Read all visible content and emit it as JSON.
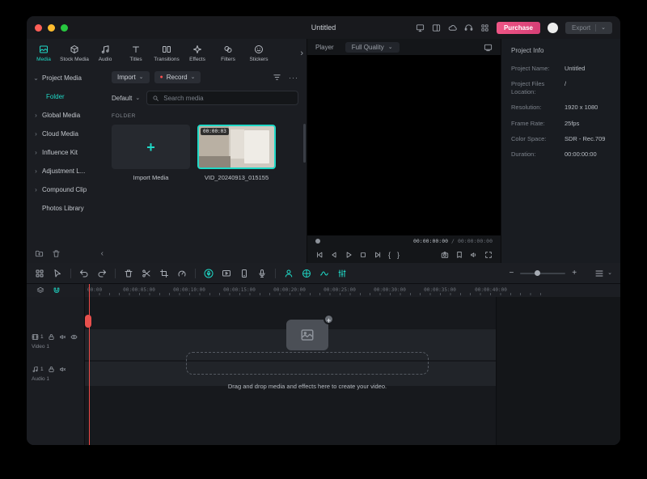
{
  "glyphs": {
    "caret_down": "⌄",
    "chevron_right": "›",
    "chevron_left": "‹",
    "plus": "+",
    "minus": "−",
    "more": "···",
    "record_dot": "●",
    "slash": "/",
    "mark_in": "{",
    "mark_out": "}"
  },
  "titlebar": {
    "title": "Untitled",
    "purchase_label": "Purchase",
    "export_label": "Export"
  },
  "media_panel": {
    "tabs": [
      {
        "label": "Media"
      },
      {
        "label": "Stock Media"
      },
      {
        "label": "Audio"
      },
      {
        "label": "Titles"
      },
      {
        "label": "Transitions"
      },
      {
        "label": "Effects"
      },
      {
        "label": "Filters"
      },
      {
        "label": "Stickers"
      }
    ],
    "sidebar": [
      {
        "label": "Project Media",
        "chevron": "⌄"
      },
      {
        "label": "Folder",
        "chevron": ""
      },
      {
        "label": "Global Media",
        "chevron": "›"
      },
      {
        "label": "Cloud Media",
        "chevron": "›"
      },
      {
        "label": "Influence Kit",
        "chevron": "›"
      },
      {
        "label": "Adjustment L...",
        "chevron": "›"
      },
      {
        "label": "Compound Clip",
        "chevron": "›"
      },
      {
        "label": "Photos Library",
        "chevron": ""
      }
    ],
    "import_label": "Import",
    "record_label": "Record",
    "sort_label": "Default",
    "search_placeholder": "Search media",
    "section_label": "FOLDER",
    "import_tile_label": "Import Media",
    "video_item": {
      "name": "VID_20240913_015155",
      "duration": "00:00:03"
    }
  },
  "preview": {
    "player_label": "Player",
    "quality_label": "Full Quality",
    "current_time": "00:00:00:00",
    "total_time": "00:00:00:00"
  },
  "project_info": {
    "title": "Project Info",
    "fields": [
      {
        "label": "Project Name:",
        "value": "Untitled"
      },
      {
        "label": "Project Files Location:",
        "value": "/"
      },
      {
        "label": "Resolution:",
        "value": "1920 x 1080"
      },
      {
        "label": "Frame Rate:",
        "value": "25fps"
      },
      {
        "label": "Color Space:",
        "value": "SDR - Rec.709"
      },
      {
        "label": "Duration:",
        "value": "00:00:00:00"
      }
    ]
  },
  "timeline": {
    "ruler_labels": [
      "00:00",
      "00:00:05:00",
      "00:00:10:00",
      "00:00:15:00",
      "00:00:20:00",
      "00:00:25:00",
      "00:00:30:00",
      "00:00:35:00",
      "00:00:40:00"
    ],
    "tracks": [
      {
        "name": "Video 1",
        "number": "1"
      },
      {
        "name": "Audio 1",
        "number": "1"
      }
    ],
    "dropzone_text": "Drag and drop media and effects here to create your video."
  },
  "colors": {
    "accent": "#1fd8c6",
    "purchase_pink": "#e0457b",
    "playhead_red": "#ef4a47"
  }
}
